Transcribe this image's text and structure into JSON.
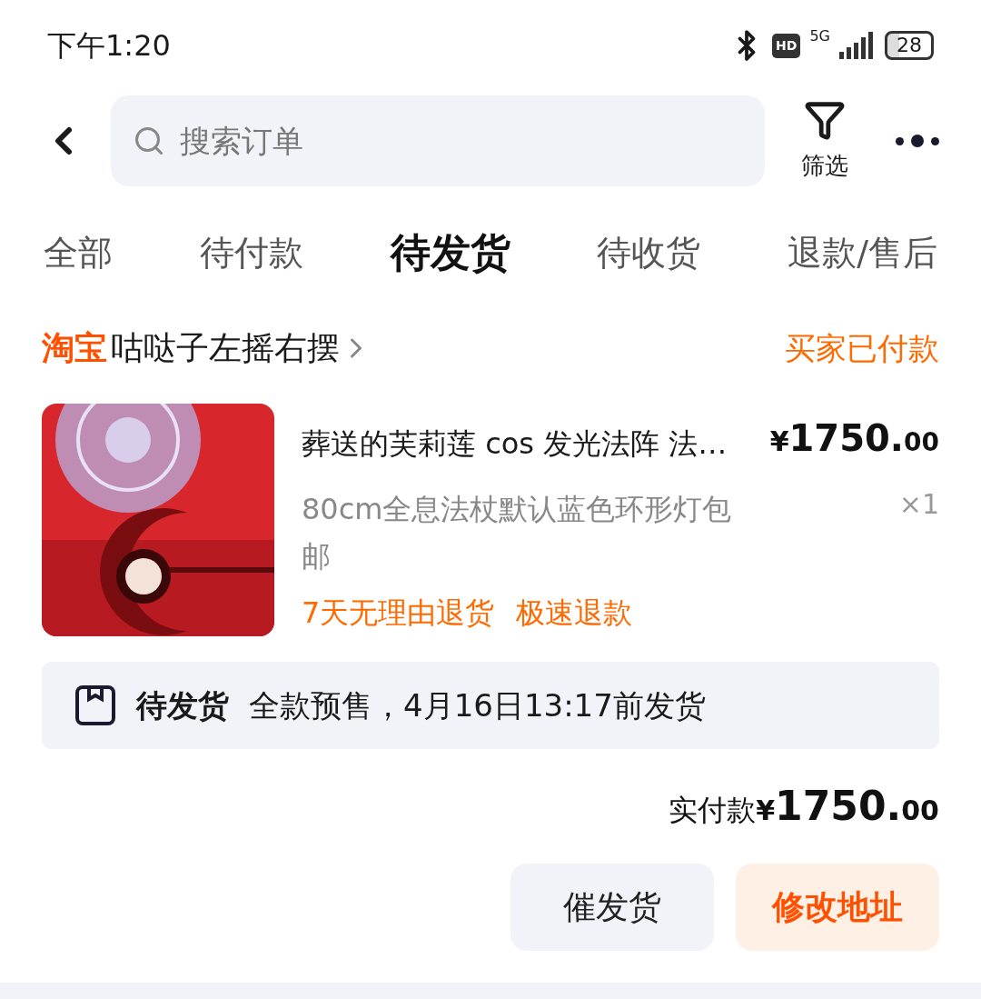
{
  "status_bar": {
    "time": "下午1:20",
    "hd": "HD",
    "network": "5G",
    "battery": "28"
  },
  "header": {
    "search": {
      "placeholder": "搜索订单"
    },
    "filter_label": "筛选"
  },
  "tabs": [
    {
      "label": "全部",
      "selected": false
    },
    {
      "label": "待付款",
      "selected": false
    },
    {
      "label": "待发货",
      "selected": true
    },
    {
      "label": "待收货",
      "selected": false
    },
    {
      "label": "退款/售后",
      "selected": false
    }
  ],
  "order": {
    "platform": "淘宝",
    "shop": "咕哒子左摇右摆",
    "status": "买家已付款",
    "item": {
      "kind": "picture",
      "title": "葬送的芙莉莲 cos 发光法阵 法…",
      "variant": "80cm全息法杖默认蓝色环形灯包邮",
      "price": {
        "currency": "¥",
        "integer": "1750.",
        "decimal": "00"
      },
      "quantity": "×1",
      "tags": [
        "7天无理由退货",
        "极速退款"
      ]
    },
    "shipping": {
      "label": "待发货",
      "note": "全款预售，4月16日13:17前发货"
    },
    "paid": {
      "label": "实付款",
      "currency": "¥",
      "integer": "1750.",
      "decimal": "00"
    },
    "buttons": [
      {
        "label": "催发货",
        "kind": "secondary"
      },
      {
        "label": "修改地址",
        "kind": "primary"
      }
    ]
  }
}
